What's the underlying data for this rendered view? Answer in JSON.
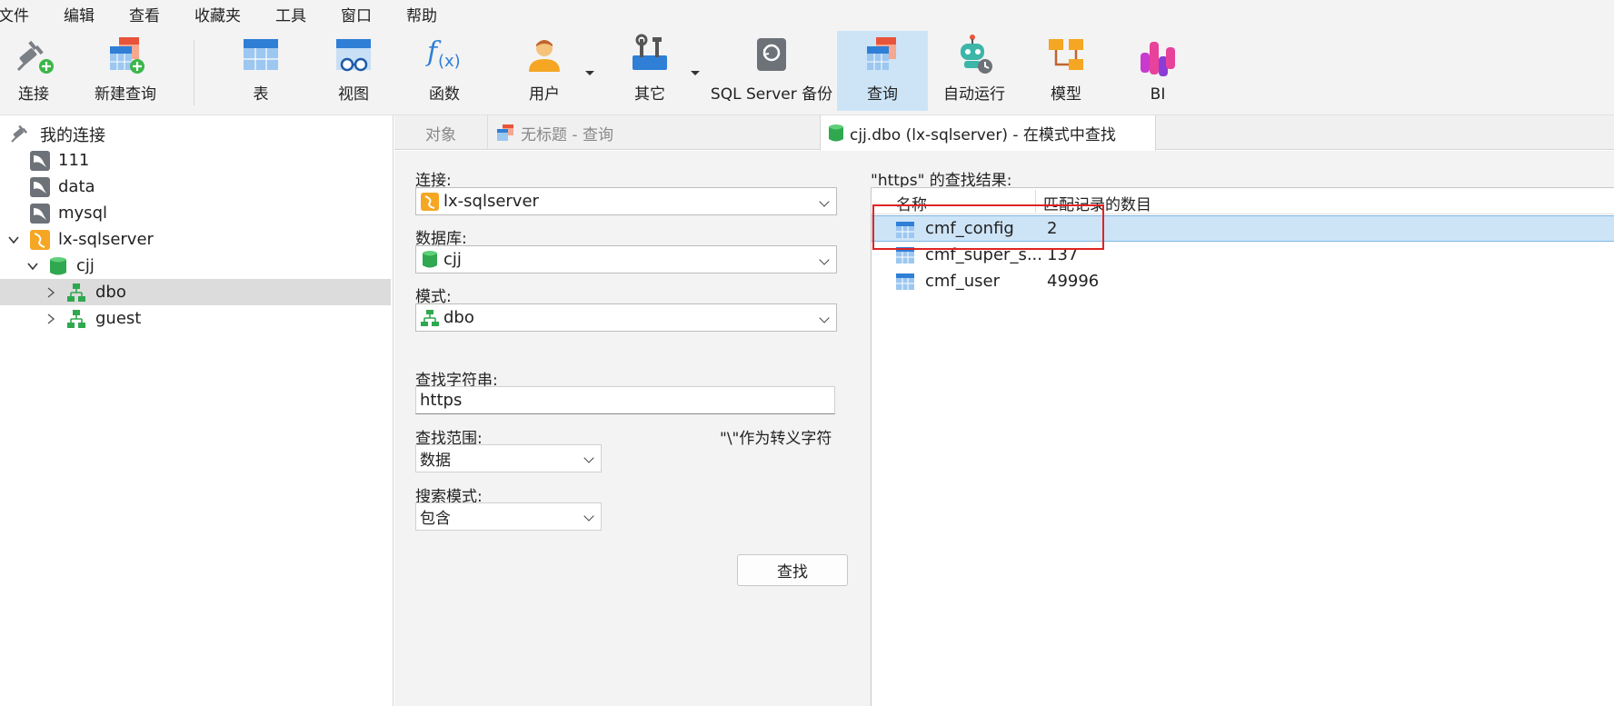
{
  "menubar": {
    "items": [
      "文件",
      "编辑",
      "查看",
      "收藏夹",
      "工具",
      "窗口",
      "帮助"
    ]
  },
  "toolbar": {
    "connect": "连接",
    "new_query": "新建查询",
    "table": "表",
    "view": "视图",
    "function": "函数",
    "user": "用户",
    "other": "其它",
    "backup": "SQL Server 备份",
    "query": "查询",
    "auto_run": "自动运行",
    "model": "模型",
    "bi": "BI"
  },
  "tree": {
    "root": "我的连接",
    "items": [
      {
        "label": "111",
        "icon": "mysql-connection-icon"
      },
      {
        "label": "data",
        "icon": "mysql-connection-icon"
      },
      {
        "label": "mysql",
        "icon": "mysql-connection-icon"
      },
      {
        "label": "lx-sqlserver",
        "icon": "sqlserver-connection-icon"
      },
      {
        "label": "cjj",
        "icon": "database-icon"
      },
      {
        "label": "dbo",
        "icon": "schema-icon"
      },
      {
        "label": "guest",
        "icon": "schema-icon"
      }
    ]
  },
  "tabs": {
    "objects": "对象",
    "untitled_query": "无标题 - 查询",
    "find_in_schema": "cjj.dbo (lx-sqlserver) - 在模式中查找"
  },
  "form": {
    "connection_label": "连接:",
    "connection_value": "lx-sqlserver",
    "database_label": "数据库:",
    "database_value": "cjj",
    "schema_label": "模式:",
    "schema_value": "dbo",
    "search_label": "查找字符串:",
    "search_value": "https",
    "scope_label": "查找范围:",
    "escape_hint": "\"\\\"作为转义字符",
    "scope_value": "数据",
    "mode_label": "搜索模式:",
    "mode_value": "包含",
    "find_button": "查找"
  },
  "results": {
    "title": "\"https\" 的查找结果:",
    "col_name": "名称",
    "col_count": "匹配记录的数目",
    "rows": [
      {
        "name": "cmf_config",
        "count": "2"
      },
      {
        "name": "cmf_super_s...",
        "count": "137"
      },
      {
        "name": "cmf_user",
        "count": "49996"
      }
    ]
  },
  "colors": {
    "selected_row": "#cde4f7",
    "highlight_box": "#e02424",
    "tree_selected": "#dcdcdc"
  }
}
